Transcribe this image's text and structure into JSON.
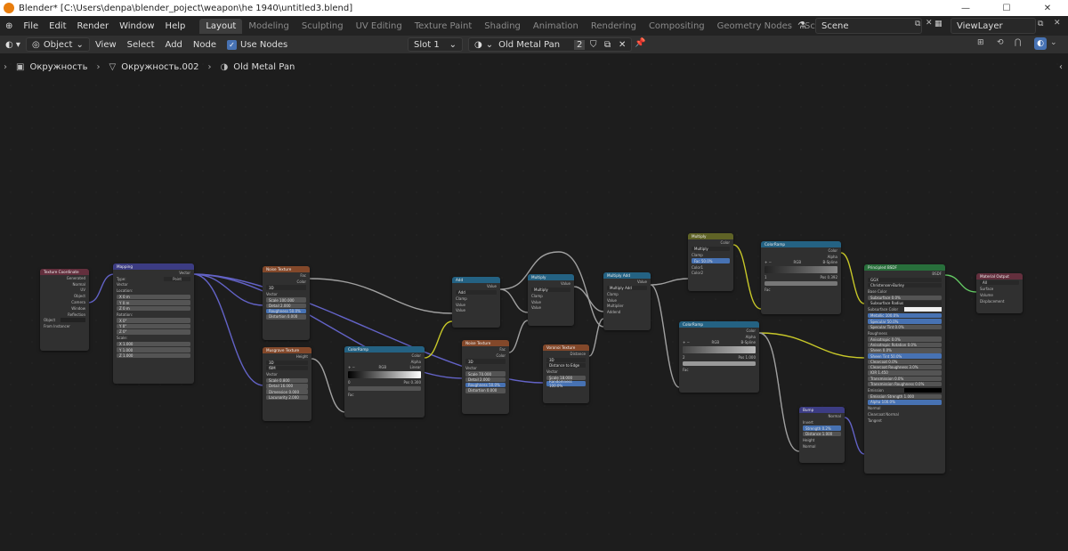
{
  "window": {
    "title": "Blender* [C:\\Users\\denpa\\blender_poject\\weapon\\he 1940\\untitled3.blend]",
    "controls": [
      "—",
      "☐",
      "✕"
    ]
  },
  "topbar": {
    "menus": [
      "File",
      "Edit",
      "Render",
      "Window",
      "Help"
    ],
    "workspaces": [
      "Layout",
      "Modeling",
      "Sculpting",
      "UV Editing",
      "Texture Paint",
      "Shading",
      "Animation",
      "Rendering",
      "Compositing",
      "Geometry Nodes",
      "Scripting"
    ],
    "add_tab": "+",
    "scene": "Scene",
    "view_layer": "ViewLayer"
  },
  "header": {
    "mode": "Object",
    "menus": [
      "View",
      "Select",
      "Add",
      "Node"
    ],
    "use_nodes_label": "Use Nodes",
    "slot": "Slot 1",
    "material": "Old Metal Pan",
    "users": "2"
  },
  "breadcrumb": [
    "Окружность",
    "Окружность.002",
    "Old Metal Pan"
  ],
  "colors": {
    "accent": "#4772b3",
    "vector_link": "#6363c7",
    "float_link": "#a1a1a1",
    "color_link": "#c7c729",
    "shader_link": "#63c763"
  },
  "nodes": {
    "texcoord": {
      "title": "Texture Coordinate",
      "outputs": [
        "Generated",
        "Normal",
        "UV",
        "Object",
        "Camera",
        "Window",
        "Reflection"
      ],
      "object_label": "Object",
      "from_instancer": "From Instancer"
    },
    "mapping": {
      "title": "Mapping",
      "output": "Vector",
      "type_label": "Type:",
      "type_value": "Point",
      "vector": "Vector",
      "location": "Location:",
      "loc": [
        "X 0 m",
        "Y 0 m",
        "Z 0 m"
      ],
      "rotation": "Rotation:",
      "rot": [
        "X 0°",
        "Y 0°",
        "Z 0°"
      ],
      "scale": "Scale:",
      "scl": [
        "X 1.000",
        "Y 1.000",
        "Z 1.000"
      ]
    },
    "noise1": {
      "title": "Noise Texture",
      "outputs": [
        "Fac",
        "Color"
      ],
      "dim": "3D",
      "vector": "Vector",
      "scale": "Scale 100.000",
      "detail": "Detail 2.000",
      "rough": "Roughness 50.0%",
      "distortion": "Distortion 0.000"
    },
    "musgrave": {
      "title": "Musgrave Texture",
      "output": "Height",
      "dim": "3D",
      "type": "fBM",
      "vector": "Vector",
      "scale": "Scale 0.800",
      "detail": "Detail 16.000",
      "dimension": "Dimension 0.000",
      "lacunarity": "Lacunarity 2.000"
    },
    "ramp1": {
      "title": "ColorRamp",
      "outputs": [
        "Color",
        "Alpha"
      ],
      "mode": "RGB",
      "interp": "Linear",
      "stop": "0",
      "pos": "Pos 0.300",
      "fac": "Fac"
    },
    "add": {
      "title": "Add",
      "output": "Value",
      "op": "Add",
      "clamp": "Clamp",
      "inputs": [
        "Value",
        "Value"
      ]
    },
    "noise2": {
      "title": "Noise Texture",
      "outputs": [
        "Fac",
        "Color"
      ],
      "dim": "3D",
      "vector": "Vector",
      "scale": "Scale 70.000",
      "detail": "Detail 2.000",
      "rough": "Roughness 50.0%",
      "distortion": "Distortion 0.000"
    },
    "multiply1": {
      "title": "Multiply",
      "output": "Value",
      "op": "Multiply",
      "clamp": "Clamp",
      "inputs": [
        "Value",
        "Value"
      ]
    },
    "voronoi": {
      "title": "Voronoi Texture",
      "output": "Distance",
      "dim": "3D",
      "feature": "Distance to Edge",
      "vector": "Vector",
      "scale": "Scale 18.000",
      "random": "Randomness 100.0%"
    },
    "multiplyadd": {
      "title": "Multiply Add",
      "output": "Value",
      "op": "Multiply Add",
      "clamp": "Clamp",
      "inputs": [
        "Value",
        "Multiplier",
        "Addend"
      ]
    },
    "mix": {
      "title": "Multiply",
      "output": "Color",
      "op": "Multiply",
      "clamp": "Clamp",
      "fac": "Fac 50.0%",
      "inputs": [
        "Color1",
        "Color2"
      ]
    },
    "ramp2": {
      "title": "ColorRamp",
      "outputs": [
        "Color",
        "Alpha"
      ],
      "mode": "RGB",
      "interp": "B-Spline",
      "stop": "1",
      "pos": "Pos 0.392",
      "fac": "Fac"
    },
    "ramp3": {
      "title": "ColorRamp",
      "outputs": [
        "Color",
        "Alpha"
      ],
      "mode": "RGB",
      "interp": "B-Spline",
      "stop": "2",
      "pos": "Pos 1.000",
      "fac": "Fac"
    },
    "bump": {
      "title": "Bump",
      "output": "Normal",
      "invert": "Invert",
      "strength": "Strength 0.2%",
      "distance": "Distance 1.000",
      "inputs": [
        "Height",
        "Normal"
      ]
    },
    "bsdf": {
      "title": "Principled BSDF",
      "output": "BSDF",
      "dist": "GGX",
      "sss": "Christensen-Burley",
      "rows": [
        "Base Color",
        "Subsurface 0.0%",
        "Subsurface Radius",
        "Subsurface Color",
        "Metallic 100.0%",
        "Specular 50.0%",
        "Specular Tint 0.0%",
        "Roughness",
        "Anisotropic 0.0%",
        "Anisotropic Rotation 0.0%",
        "Sheen 0.0%",
        "Sheen Tint 50.0%",
        "Clearcoat 0.0%",
        "Clearcoat Roughness 3.0%",
        "IOR 1.450",
        "Transmission 0.0%",
        "Transmission Roughness 0.0%",
        "Emission",
        "Emission Strength 1.000",
        "Alpha 100.0%",
        "Normal",
        "Clearcoat Normal",
        "Tangent"
      ]
    },
    "output": {
      "title": "Material Output",
      "target": "All",
      "inputs": [
        "Surface",
        "Volume",
        "Displacement"
      ]
    }
  }
}
